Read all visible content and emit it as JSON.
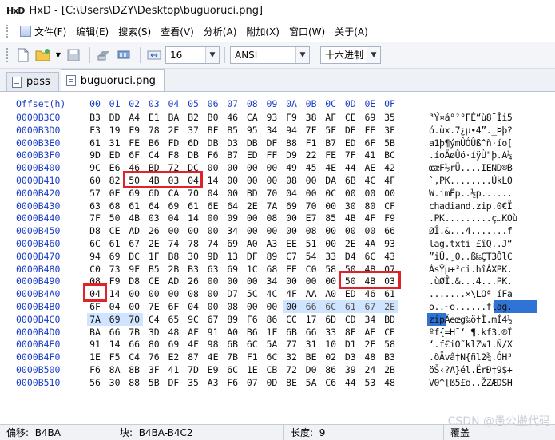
{
  "window": {
    "app_logo": "HxD",
    "title": "HxD - [C:\\Users\\DZY\\Desktop\\buguoruci.png]"
  },
  "menu": [
    {
      "label": "文件(F)"
    },
    {
      "label": "编辑(E)"
    },
    {
      "label": "搜索(S)"
    },
    {
      "label": "查看(V)"
    },
    {
      "label": "分析(A)"
    },
    {
      "label": "附加(X)"
    },
    {
      "label": "窗口(W)"
    },
    {
      "label": "关于(A)"
    }
  ],
  "toolbar": {
    "bytes_per_row": "16",
    "charset": "ANSI",
    "offset_base": "十六进制"
  },
  "tabs": [
    {
      "label": "pass",
      "active": false
    },
    {
      "label": "buguoruci.png",
      "active": true
    }
  ],
  "hex_view": {
    "header_label": "Offset(h)",
    "columns": [
      "00",
      "01",
      "02",
      "03",
      "04",
      "05",
      "06",
      "07",
      "08",
      "09",
      "0A",
      "0B",
      "0C",
      "0D",
      "0E",
      "0F"
    ],
    "rows": [
      {
        "offset": "0000B3C0",
        "bytes": [
          "B3",
          "DD",
          "A4",
          "E1",
          "BA",
          "B2",
          "B0",
          "46",
          "CA",
          "93",
          "F9",
          "38",
          "AF",
          "CE",
          "69",
          "35"
        ],
        "ascii": "³Ý¤á°²°FÊ“ù8¯Îi5"
      },
      {
        "offset": "0000B3D0",
        "bytes": [
          "F3",
          "19",
          "F9",
          "78",
          "2E",
          "37",
          "BF",
          "B5",
          "95",
          "34",
          "94",
          "7F",
          "5F",
          "DE",
          "FE",
          "3F"
        ],
        "ascii": "ó.ùx.7¿µ•4”._Þþ?"
      },
      {
        "offset": "0000B3E0",
        "bytes": [
          "61",
          "31",
          "FE",
          "B6",
          "FD",
          "6D",
          "DB",
          "D3",
          "DB",
          "DF",
          "88",
          "F1",
          "B7",
          "ED",
          "6F",
          "5B"
        ],
        "ascii": "a1þ¶ýmÛÓÛß^ñ·ío["
      },
      {
        "offset": "0000B3F0",
        "bytes": [
          "9D",
          "ED",
          "6F",
          "C4",
          "F8",
          "DB",
          "F6",
          "B7",
          "ED",
          "FF",
          "D9",
          "22",
          "FE",
          "7F",
          "41",
          "BC"
        ],
        "ascii": ".íoÄøÛö·íÿÙ\"þ.A¼"
      },
      {
        "offset": "0000B400",
        "bytes": [
          "9C",
          "E6",
          "46",
          "BD",
          "72",
          "DC",
          "00",
          "00",
          "00",
          "00",
          "49",
          "45",
          "4E",
          "44",
          "AE",
          "42"
        ],
        "ascii": "œæF½rÜ....IEND®B"
      },
      {
        "offset": "0000B410",
        "bytes": [
          "60",
          "82",
          "50",
          "4B",
          "03",
          "04",
          "14",
          "00",
          "00",
          "00",
          "08",
          "00",
          "DA",
          "6B",
          "4C",
          "4F"
        ],
        "ascii": "`‚PK........ÚkLO"
      },
      {
        "offset": "0000B420",
        "bytes": [
          "57",
          "0E",
          "69",
          "6D",
          "CA",
          "70",
          "04",
          "00",
          "BD",
          "70",
          "04",
          "00",
          "0C",
          "00",
          "00",
          "00"
        ],
        "ascii": "W.imÊp..½p......"
      },
      {
        "offset": "0000B430",
        "bytes": [
          "63",
          "68",
          "61",
          "64",
          "69",
          "61",
          "6E",
          "64",
          "2E",
          "7A",
          "69",
          "70",
          "00",
          "30",
          "80",
          "CF"
        ],
        "ascii": "chadiand.zip.0€Ï"
      },
      {
        "offset": "0000B440",
        "bytes": [
          "7F",
          "50",
          "4B",
          "03",
          "04",
          "14",
          "00",
          "09",
          "00",
          "08",
          "00",
          "E7",
          "85",
          "4B",
          "4F",
          "F9"
        ],
        "ascii": ".PK.........ç…KOù"
      },
      {
        "offset": "0000B450",
        "bytes": [
          "D8",
          "CE",
          "AD",
          "26",
          "00",
          "00",
          "00",
          "34",
          "00",
          "00",
          "00",
          "08",
          "00",
          "00",
          "00",
          "66"
        ],
        "ascii": "ØÎ.&...4.......f"
      },
      {
        "offset": "0000B460",
        "bytes": [
          "6C",
          "61",
          "67",
          "2E",
          "74",
          "78",
          "74",
          "69",
          "A0",
          "A3",
          "EE",
          "51",
          "00",
          "2E",
          "4A",
          "93"
        ],
        "ascii": "lag.txti £îQ..J“"
      },
      {
        "offset": "0000B470",
        "bytes": [
          "94",
          "69",
          "DC",
          "1F",
          "B8",
          "30",
          "9D",
          "13",
          "DF",
          "89",
          "C7",
          "54",
          "33",
          "D4",
          "6C",
          "43"
        ],
        "ascii": "”iÜ.¸0..ß‰ÇT3ÔlC"
      },
      {
        "offset": "0000B480",
        "bytes": [
          "C0",
          "73",
          "9F",
          "B5",
          "2B",
          "B3",
          "63",
          "69",
          "1C",
          "68",
          "EE",
          "C0",
          "58",
          "50",
          "4B",
          "07"
        ],
        "ascii": "ÀsŸµ+³ci.hîÀXPK."
      },
      {
        "offset": "0000B490",
        "bytes": [
          "08",
          "F9",
          "D8",
          "CE",
          "AD",
          "26",
          "00",
          "00",
          "00",
          "34",
          "00",
          "00",
          "00",
          "50",
          "4B",
          "03"
        ],
        "ascii": ".ùØÎ.&...4...PK."
      },
      {
        "offset": "0000B4A0",
        "bytes": [
          "04",
          "14",
          "00",
          "00",
          "00",
          "08",
          "00",
          "D7",
          "5C",
          "4C",
          "4F",
          "AA",
          "A0",
          "ED",
          "46",
          "61"
        ],
        "ascii": ".......×\\LOª íFa"
      },
      {
        "offset": "0000B4B0",
        "bytes": [
          "6F",
          "04",
          "00",
          "7E",
          "6F",
          "04",
          "00",
          "08",
          "00",
          "00",
          "00",
          "66",
          "6C",
          "61",
          "67",
          "2E"
        ],
        "ascii": "o..~o......flag."
      },
      {
        "offset": "0000B4C0",
        "bytes": [
          "7A",
          "69",
          "70",
          "C4",
          "65",
          "9C",
          "67",
          "89",
          "F6",
          "86",
          "CC",
          "17",
          "6D",
          "CD",
          "34",
          "BD"
        ],
        "ascii": "zipÄeœg‰ö†Ì.mÍ4½"
      },
      {
        "offset": "0000B4D0",
        "bytes": [
          "BA",
          "66",
          "7B",
          "3D",
          "48",
          "AF",
          "91",
          "A0",
          "B6",
          "1F",
          "6B",
          "66",
          "33",
          "8F",
          "AE",
          "CE"
        ],
        "ascii": "ºf{=H¯‘ ¶.kf3.®Î"
      },
      {
        "offset": "0000B4E0",
        "bytes": [
          "91",
          "14",
          "66",
          "80",
          "69",
          "4F",
          "98",
          "6B",
          "6C",
          "5A",
          "77",
          "31",
          "10",
          "D1",
          "2F",
          "58"
        ],
        "ascii": "‘.f€iO˜klZw1.Ñ/X"
      },
      {
        "offset": "0000B4F0",
        "bytes": [
          "1E",
          "F5",
          "C4",
          "76",
          "E2",
          "87",
          "4E",
          "7B",
          "F1",
          "6C",
          "32",
          "BE",
          "02",
          "D3",
          "48",
          "B3"
        ],
        "ascii": ".õÄvâ‡N{ñl2¾.ÓH³"
      },
      {
        "offset": "0000B500",
        "bytes": [
          "F6",
          "8A",
          "8B",
          "3F",
          "41",
          "7D",
          "E9",
          "6C",
          "1E",
          "CB",
          "72",
          "D0",
          "86",
          "39",
          "24",
          "2B"
        ],
        "ascii": "öŠ‹?A}él.ËrÐ†9$+"
      },
      {
        "offset": "0000B510",
        "bytes": [
          "56",
          "30",
          "88",
          "5B",
          "DF",
          "35",
          "A3",
          "F6",
          "07",
          "0D",
          "8E",
          "5A",
          "C6",
          "44",
          "53",
          "48"
        ],
        "ascii": "V0^[ß5£ö..ŽZÆDSH"
      }
    ]
  },
  "status": {
    "offset_label": "偏移:",
    "offset_value": "B4BA",
    "block_label": "块:",
    "block_value": "B4BA-B4C2",
    "length_label": "长度:",
    "length_value": "9",
    "mode": "覆盖"
  },
  "watermark": "CSDN @愚公搬代码",
  "colors": {
    "offset_blue": "#1a3cc8",
    "highlight_red": "#e0222a",
    "selection_blue": "#2f73d6"
  }
}
